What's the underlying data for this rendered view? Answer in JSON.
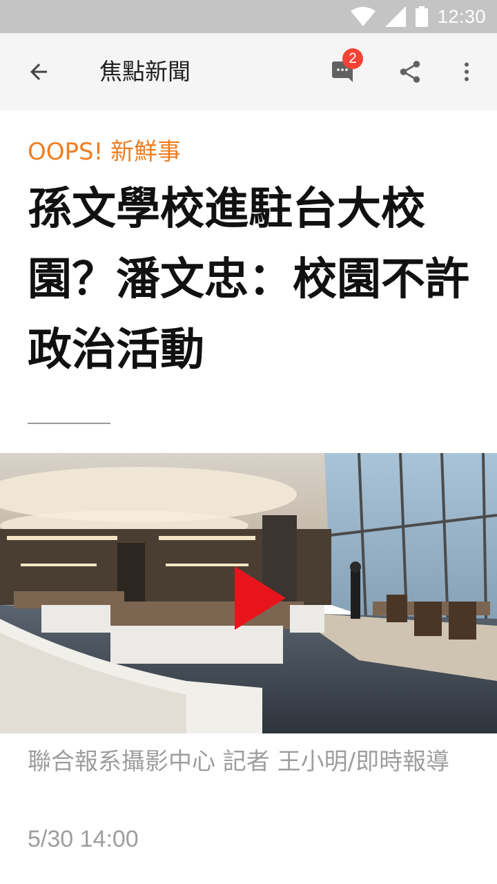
{
  "status_bar": {
    "time": "12:30",
    "icons": [
      "wifi-icon",
      "signal-icon",
      "battery-icon"
    ]
  },
  "app_bar": {
    "title": "焦點新聞",
    "comment_count": "2",
    "actions": [
      "back-arrow-icon",
      "comment-icon",
      "share-icon",
      "more-vert-icon"
    ]
  },
  "article": {
    "category": "OOPS! 新鮮事",
    "headline": "孫文學校進駐台大校園？潘文忠：校園不許政治活動",
    "media": {
      "type": "video",
      "icon": "play-icon"
    },
    "byline": "聯合報系攝影中心 記者 王小明/即時報導",
    "timestamp": "5/30 14:00"
  },
  "colors": {
    "accent": "#f07d22",
    "badge": "#f44336",
    "status_bar": "#c4c4c4",
    "app_bar": "#f5f5f5",
    "play": "#e8141b"
  }
}
